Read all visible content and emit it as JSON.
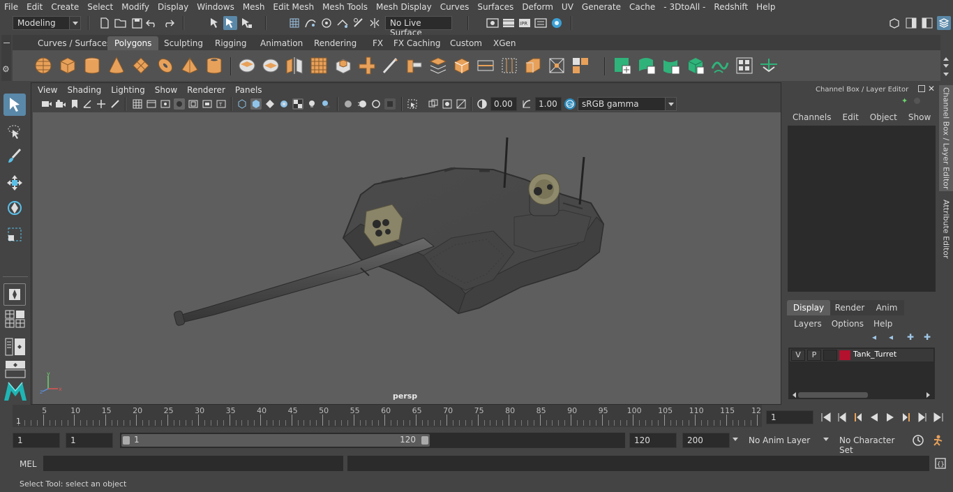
{
  "menubar": {
    "items": [
      "File",
      "Edit",
      "Create",
      "Select",
      "Modify",
      "Display",
      "Windows",
      "Mesh",
      "Edit Mesh",
      "Mesh Tools",
      "Mesh Display",
      "Curves",
      "Surfaces",
      "Deform",
      "UV",
      "Generate",
      "Cache",
      "- 3DtoAll -",
      "Redshift",
      "Help"
    ]
  },
  "statusline": {
    "workspace": "Modeling",
    "live_surface": "No Live Surface"
  },
  "shelf": {
    "tabs": [
      "Curves / Surfaces",
      "Polygons",
      "Sculpting",
      "Rigging",
      "Animation",
      "Rendering",
      "FX",
      "FX Caching",
      "Custom",
      "XGen"
    ],
    "active_tab": "Polygons"
  },
  "viewport": {
    "menu": [
      "View",
      "Shading",
      "Lighting",
      "Show",
      "Renderer",
      "Panels"
    ],
    "exposure": "0.00",
    "gamma": "1.00",
    "color_space": "sRGB gamma",
    "camera": "persp"
  },
  "channel_box": {
    "title": "Channel Box / Layer Editor",
    "menu": [
      "Channels",
      "Edit",
      "Object",
      "Show"
    ]
  },
  "layer_editor": {
    "tabs": [
      "Display",
      "Render",
      "Anim"
    ],
    "active_tab": "Display",
    "menu": [
      "Layers",
      "Options",
      "Help"
    ],
    "layers": [
      {
        "v": "V",
        "p": "P",
        "color": "#b3112e",
        "name": "Tank_Turret"
      }
    ]
  },
  "side_tabs": [
    "Channel Box / Layer Editor",
    "Attribute Editor"
  ],
  "timeline": {
    "labels": [
      "5",
      "10",
      "15",
      "20",
      "25",
      "30",
      "35",
      "40",
      "45",
      "50",
      "55",
      "60",
      "65",
      "70",
      "75",
      "80",
      "85",
      "90",
      "95",
      "100",
      "105",
      "110",
      "115",
      "12"
    ],
    "first_label": "1",
    "current_frame": "1"
  },
  "range": {
    "start": "1",
    "playback_start": "1",
    "slider_start": "1",
    "slider_end": "120",
    "playback_end": "120",
    "end": "200",
    "anim_layer": "No Anim Layer",
    "character_set": "No Character Set"
  },
  "command": {
    "language": "MEL"
  },
  "help": {
    "text": "Select Tool: select an object"
  }
}
